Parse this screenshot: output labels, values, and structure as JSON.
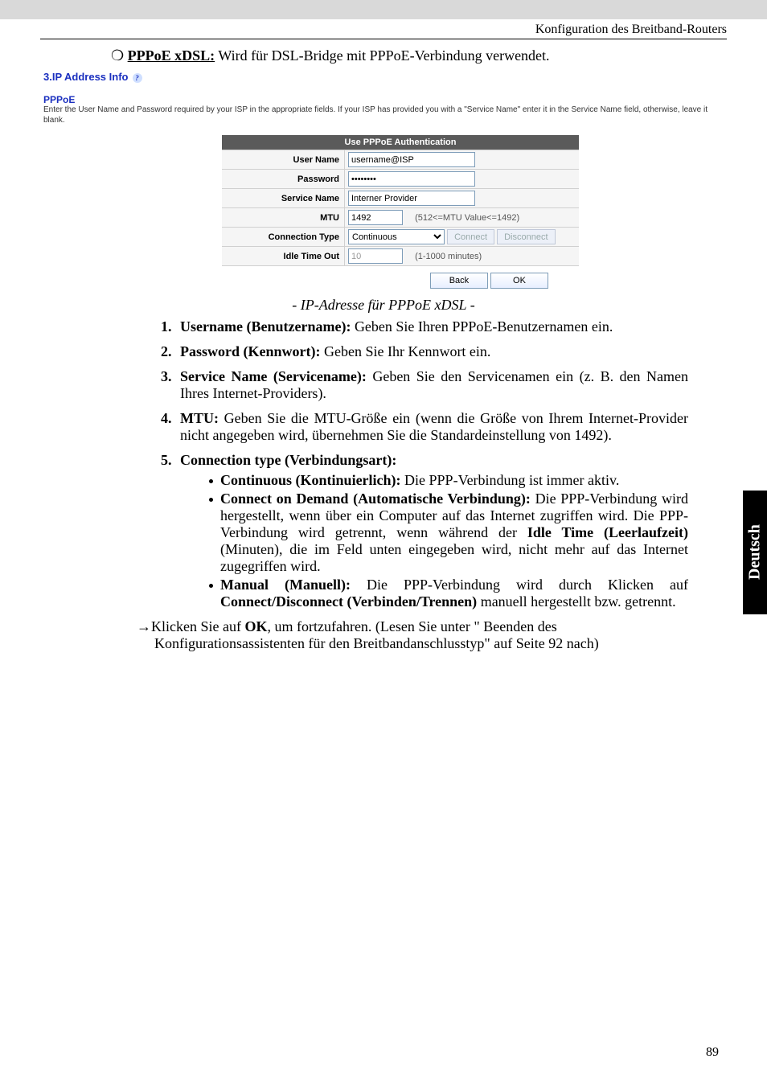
{
  "header": {
    "title": "Konfiguration des Breitband-Routers"
  },
  "intro": {
    "bullet": "❍",
    "heading": "PPPoE xDSL:",
    "text": " Wird für DSL-Bridge mit PPPoE-Verbindung verwendet."
  },
  "shot": {
    "section_title": "3.IP Address Info",
    "help_glyph": "?",
    "pppoe_title": "PPPoE",
    "description": "Enter the User Name and Password required by your ISP in the appropriate fields. If your ISP has provided you with a \"Service Name\" enter it in the Service Name field, otherwise, leave it blank.",
    "table_header": "Use PPPoE Authentication",
    "rows": {
      "user_name": {
        "label": "User Name",
        "value": "username@ISP"
      },
      "password": {
        "label": "Password",
        "value": "••••••••"
      },
      "service_name": {
        "label": "Service Name",
        "value": "Interner Provider"
      },
      "mtu": {
        "label": "MTU",
        "value": "1492",
        "hint": "(512<=MTU Value<=1492)"
      },
      "connection_type": {
        "label": "Connection Type",
        "value": "Continuous",
        "connect": "Connect",
        "disconnect": "Disconnect"
      },
      "idle": {
        "label": "Idle Time Out",
        "value": "10",
        "hint": "(1-1000 minutes)"
      }
    },
    "buttons": {
      "back": "Back",
      "ok": "OK"
    }
  },
  "caption": "- IP-Adresse für PPPoE xDSL -",
  "list": {
    "i1": {
      "b": "Username (Benutzername): ",
      "t": "Geben Sie Ihren PPPoE-Benutzernamen ein."
    },
    "i2": {
      "b": "Password (Kennwort): ",
      "t": "Geben Sie Ihr Kennwort ein."
    },
    "i3": {
      "b": "Service Name (Servicename): ",
      "t": "Geben Sie den Servicenamen ein (z. B. den Namen Ihres Internet-Providers)."
    },
    "i4": {
      "b": "MTU: ",
      "t": "Geben Sie die MTU-Größe ein (wenn die Größe von Ihrem Internet-Provider nicht angegeben wird, übernehmen Sie die Standardeinstellung von 1492)."
    },
    "i5": {
      "b": "Connection type (Verbindungsart):",
      "s1": {
        "b": "Continuous (Kontinuierlich): ",
        "t": "Die PPP-Verbindung ist immer aktiv."
      },
      "s2": {
        "b1": "Connect on Demand (Automatische Verbindung): ",
        "t1": "Die PPP-Verbindung wird hergestellt, wenn über ein Computer auf das Internet zugriffen wird. Die PPP-Verbindung wird getrennt, wenn während der ",
        "b2": "Idle Time (Leerlaufzeit) ",
        "t2": "(Minuten), die im Feld unten eingegeben wird, nicht mehr auf das Internet zugegriffen wird."
      },
      "s3": {
        "b1": "Manual (Manuell): ",
        "t1": "Die PPP-Verbindung wird durch Klicken auf ",
        "b2": "Connect/Disconnect (Verbinden/Trennen) ",
        "t2": "manuell hergestellt bzw. getrennt."
      }
    }
  },
  "footer": {
    "arrow": "→",
    "l1a": "Klicken Sie auf ",
    "l1b": "OK",
    "l1c": ", um fortzufahren. (Lesen Sie unter \" Beenden des",
    "l2": "Konfigurationsassistenten für den Breitbandanschlusstyp\"  auf Seite  92 nach)"
  },
  "side_tab": "Deutsch",
  "page_number": "89"
}
